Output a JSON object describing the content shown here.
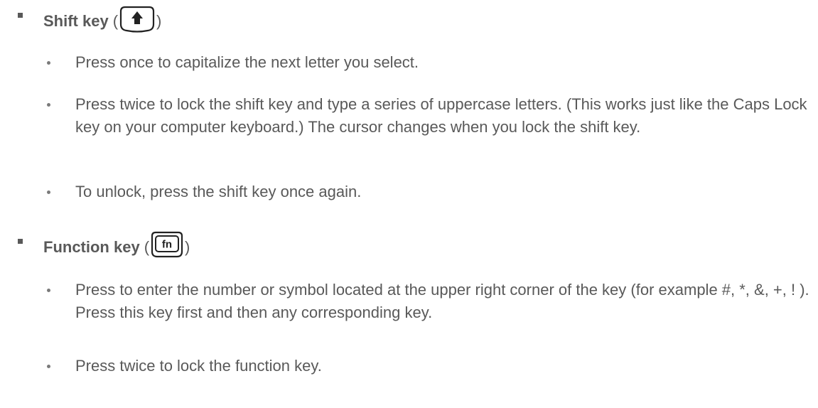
{
  "shift": {
    "title": "Shift key",
    "paren_open": "(",
    "paren_close": ")",
    "icon": "shift-arrow-icon",
    "items": [
      "Press once to capitalize the next letter you select.",
      "Press twice to lock the shift key and type a series of uppercase letters. (This works just like the Caps Lock key on your computer keyboard.) The cursor changes when you lock the shift key.",
      "To unlock, press the shift key once again."
    ]
  },
  "function": {
    "title": "Function key",
    "paren_open": "(",
    "paren_close": ")",
    "icon": "fn-key-icon",
    "key_label": "fn",
    "items": [
      "Press to enter the number or symbol located at the upper right corner of the key (for example #, *, &, +, ! ). Press this key first and then any corresponding key.",
      "Press twice to lock the function key."
    ]
  }
}
